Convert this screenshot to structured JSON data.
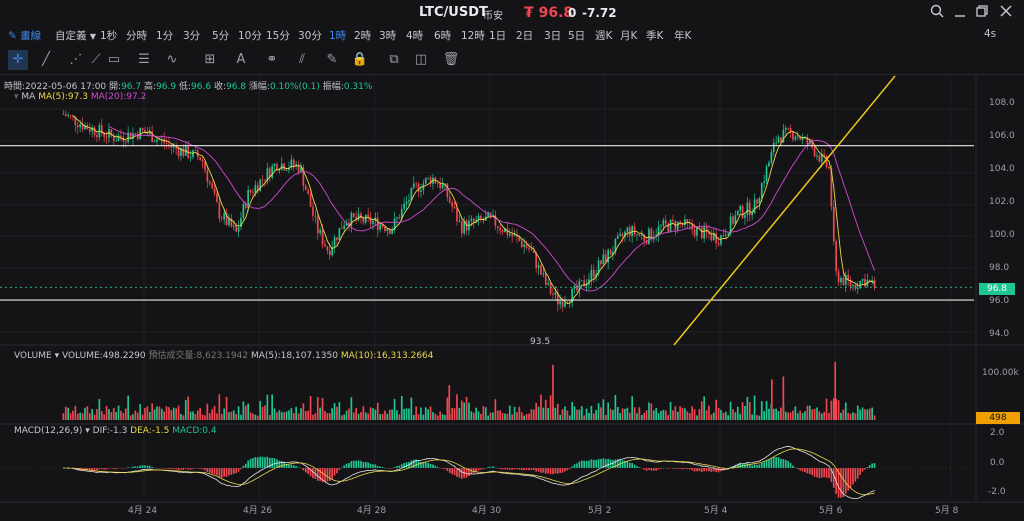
{
  "window": {
    "pair": "LTC/USDT",
    "exchange": "币安",
    "price": "₮ 96.8",
    "change_zero": "0",
    "change": "-7.72",
    "buttons": [
      "search-icon",
      "minimize-icon",
      "restore-icon",
      "close-icon"
    ]
  },
  "toolbar": {
    "draw_label": "畫線",
    "custom_label": "自定義",
    "timeframes": [
      "1秒",
      "分時",
      "1分",
      "3分",
      "5分",
      "10分",
      "15分",
      "30分",
      "1時",
      "2時",
      "3時",
      "4時",
      "6時",
      "12時",
      "1日",
      "2日",
      "3日",
      "5日",
      "週K",
      "月K",
      "季K",
      "年K"
    ],
    "active_timeframe": "1時",
    "refresh": "4s",
    "tools": [
      "crosshair-icon",
      "line-icon",
      "multi-line-icon",
      "ray-icon",
      "rectangle-icon",
      "horizontal-lines-icon",
      "wave-icon",
      "plus-box-icon",
      "text-icon",
      "link-icon",
      "ruler-icon",
      "pen-icon",
      "lock-icon",
      "copy-icon",
      "layers-icon",
      "trash-icon"
    ]
  },
  "info": {
    "time_label": "時間:",
    "time": "2022-05-06 17:00",
    "open_label": "開:",
    "open": "96.7",
    "high_label": "高:",
    "high": "96.9",
    "low_label": "低:",
    "low": "96.6",
    "close_label": "收:",
    "close": "96.8",
    "change_label": "漲幅:",
    "change": "0.10%(0.1)",
    "amp_label": "振幅:",
    "amp": "0.31%"
  },
  "ma": {
    "name": "MA",
    "ma5": "MA(5):97.3",
    "ma20": "MA(20):97.2"
  },
  "volume": {
    "name": "VOLUME",
    "value": "VOLUME:498.2290",
    "est": "預估成交量:8,623.1942",
    "ma5": "MA(5):18,107.1350",
    "ma10": "MA(10):16,313.2664",
    "axis_label": "100.00k",
    "last_badge": "498"
  },
  "macd": {
    "name": "MACD(12,26,9)",
    "dif": "DIF:-1.3",
    "dea": "DEA:-1.5",
    "macd": "MACD:0.4",
    "axis": [
      "2.0",
      "0.0",
      "-2.0"
    ]
  },
  "price_axis": [
    "108.0",
    "106.0",
    "104.0",
    "102.0",
    "100.0",
    "98.0",
    "96.0",
    "94.0"
  ],
  "last_price_badge": "96.8",
  "low_marker": "93.5",
  "x_axis_labels": [
    "4月 24",
    "4月 26",
    "4月 28",
    "4月 30",
    "5月 2",
    "5月 4",
    "5月 6",
    "5月 8"
  ],
  "chart_data": {
    "type": "candlestick",
    "symbol": "LTC/USDT",
    "interval": "1h",
    "y_range": [
      93.3,
      109.2
    ],
    "horizontal_lines": [
      105.7,
      96.0
    ],
    "trendline": {
      "from": {
        "time": "5月 2",
        "price": 93.5
      },
      "to": {
        "time": "5月 5",
        "price": 109.0
      }
    },
    "close_path": [
      {
        "day": 22.6,
        "price": 107.7
      },
      {
        "day": 23.0,
        "price": 106.9
      },
      {
        "day": 23.5,
        "price": 106.2
      },
      {
        "day": 24.0,
        "price": 106.6
      },
      {
        "day": 24.5,
        "price": 105.6
      },
      {
        "day": 25.0,
        "price": 104.9
      },
      {
        "day": 25.3,
        "price": 101.5
      },
      {
        "day": 25.6,
        "price": 100.2
      },
      {
        "day": 25.8,
        "price": 102.6
      },
      {
        "day": 26.3,
        "price": 104.6
      },
      {
        "day": 26.7,
        "price": 104.4
      },
      {
        "day": 27.0,
        "price": 100.5
      },
      {
        "day": 27.2,
        "price": 99.1
      },
      {
        "day": 27.5,
        "price": 101.1
      },
      {
        "day": 28.0,
        "price": 100.9
      },
      {
        "day": 28.3,
        "price": 100.5
      },
      {
        "day": 28.7,
        "price": 103.0
      },
      {
        "day": 29.0,
        "price": 103.7
      },
      {
        "day": 29.2,
        "price": 103.1
      },
      {
        "day": 29.5,
        "price": 100.6
      },
      {
        "day": 30.0,
        "price": 101.1
      },
      {
        "day": 30.3,
        "price": 100.3
      },
      {
        "day": 30.7,
        "price": 99.2
      },
      {
        "day": 31.0,
        "price": 96.8
      },
      {
        "day": 31.2,
        "price": 95.9
      },
      {
        "day": 31.5,
        "price": 96.5
      },
      {
        "day": 32.0,
        "price": 98.6
      },
      {
        "day": 32.4,
        "price": 100.4
      },
      {
        "day": 32.7,
        "price": 99.9
      },
      {
        "day": 33.0,
        "price": 100.6
      },
      {
        "day": 33.3,
        "price": 100.8
      },
      {
        "day": 33.7,
        "price": 100.2
      },
      {
        "day": 34.0,
        "price": 99.9
      },
      {
        "day": 34.3,
        "price": 101.4
      },
      {
        "day": 34.6,
        "price": 101.9
      },
      {
        "day": 35.0,
        "price": 106.3
      },
      {
        "day": 35.3,
        "price": 106.5
      },
      {
        "day": 35.6,
        "price": 105.6
      },
      {
        "day": 35.9,
        "price": 104.2
      },
      {
        "day": 36.0,
        "price": 97.6
      },
      {
        "day": 36.3,
        "price": 96.9
      },
      {
        "day": 36.5,
        "price": 97.3
      },
      {
        "day": 36.7,
        "price": 96.8
      }
    ],
    "volume_axis": "100.00k",
    "macd_range": [
      -2.4,
      2.4
    ]
  }
}
